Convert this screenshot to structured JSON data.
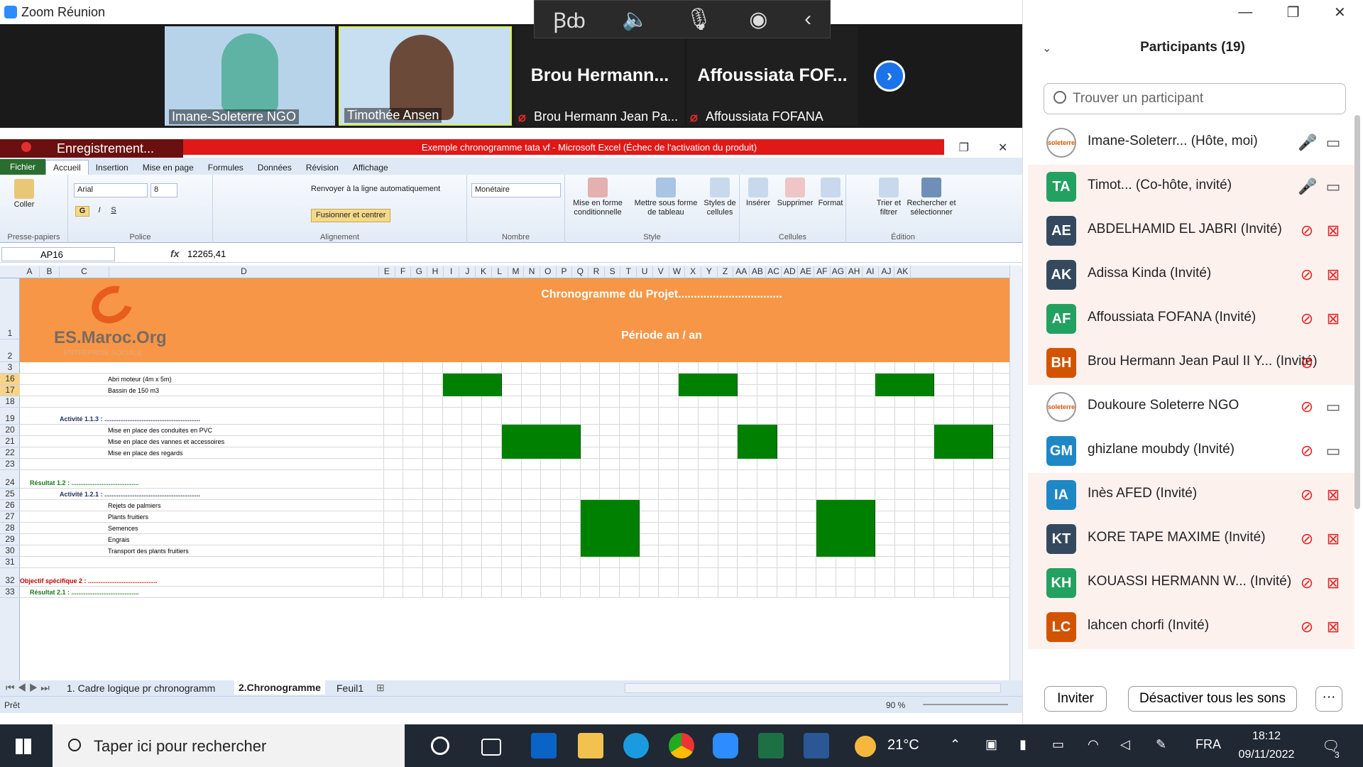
{
  "zoom": {
    "window_title": "Zoom Réunion",
    "floating_bar_icons": [
      "accessibility-icon",
      "speaker-icon",
      "mic-icon",
      "broadcast-icon",
      "back-icon"
    ],
    "videos": [
      {
        "name": "Imane-Soleterre NGO"
      },
      {
        "name": "Timothée Ansen"
      }
    ],
    "name_tiles": [
      {
        "big": "Brou Hermann...",
        "small": "Brou Hermann Jean Pa..."
      },
      {
        "big": "Affoussiata FOF...",
        "small": "Affoussiata FOFANA"
      }
    ],
    "recording": "Enregistrement..."
  },
  "excel": {
    "title": "Exemple chronogramme tata vf - Microsoft Excel (Échec de l'activation du produit)",
    "tabs": [
      "Fichier",
      "Accueil",
      "Insertion",
      "Mise en page",
      "Formules",
      "Données",
      "Révision",
      "Affichage"
    ],
    "ribbon": {
      "coller": "Coller",
      "presse_papiers": "Presse-papiers",
      "font_name": "Arial",
      "font_size": "8",
      "police": "Police",
      "wrap": "Renvoyer à la ligne automatiquement",
      "merge": "Fusionner et centrer",
      "alignement": "Alignement",
      "number_format": "Monétaire",
      "nombre": "Nombre",
      "cond_format": "Mise en forme conditionnelle",
      "table_format": "Mettre sous forme de tableau",
      "cell_styles": "Styles de cellules",
      "style": "Style",
      "inserer": "Insérer",
      "supprimer": "Supprimer",
      "format": "Format",
      "cellules": "Cellules",
      "trier": "Trier et filtrer",
      "rechercher": "Rechercher et sélectionner",
      "edition": "Édition"
    },
    "name_box": "AP16",
    "formula_value": "12265,41",
    "columns": [
      "A",
      "B",
      "C",
      "D",
      "E",
      "F",
      "G",
      "H",
      "I",
      "J",
      "K",
      "L",
      "M",
      "N",
      "O",
      "P",
      "Q",
      "R",
      "S",
      "T",
      "U",
      "V",
      "W",
      "X",
      "Y",
      "Z",
      "AA",
      "AB",
      "AC",
      "AD",
      "AE",
      "AF",
      "AG",
      "AH",
      "AI",
      "AJ",
      "AK"
    ],
    "header_title": "Chronogramme du Projet.................................",
    "header_period": "Période an / an",
    "logo_text": "ES.Maroc.Org",
    "logo_sub": "ENTREPRISE SOCIALE",
    "rows": [
      {
        "num": "1",
        "text": ""
      },
      {
        "num": "2",
        "text": ""
      },
      {
        "num": "3",
        "text": ""
      },
      {
        "num": "16",
        "text": "Abri moteur (4m x 5m)"
      },
      {
        "num": "17",
        "text": "Bassin de 150 m3"
      },
      {
        "num": "18",
        "text": ""
      },
      {
        "num": "19",
        "text": "Activité 1.1.3 : ......................................................"
      },
      {
        "num": "20",
        "text": "Mise en place des conduites en PVC"
      },
      {
        "num": "21",
        "text": "Mise en place des vannes et accessoires"
      },
      {
        "num": "22",
        "text": "Mise en place des regards"
      },
      {
        "num": "23",
        "text": ""
      },
      {
        "num": "24",
        "text": "Résultat 1.2 : ......................................"
      },
      {
        "num": "25",
        "text": "Activité 1.2.1 : ......................................................"
      },
      {
        "num": "26",
        "text": "Rejets de palmiers"
      },
      {
        "num": "27",
        "text": "Plants fruitiers"
      },
      {
        "num": "28",
        "text": "Semences"
      },
      {
        "num": "29",
        "text": "Engrais"
      },
      {
        "num": "30",
        "text": "Transport des plants fruitiers"
      },
      {
        "num": "31",
        "text": ""
      },
      {
        "num": "32",
        "text": "Objectif spécifique 2 : ......................................."
      },
      {
        "num": "33",
        "text": "Résultat 2.1 : ......................................"
      }
    ],
    "sheet_tabs": [
      "1. Cadre logique pr chronogramm",
      "2.Chronogramme",
      "Feuil1"
    ],
    "status": "Prêt",
    "zoom": "90 %"
  },
  "participants": {
    "title": "Participants (19)",
    "search_placeholder": "Trouver un participant",
    "list": [
      {
        "initials": "",
        "name": "Imane-Soleterr...  (Hôte, moi)",
        "color": "#ffffff",
        "mic": "on",
        "cam": "on",
        "logo": "soleterre"
      },
      {
        "initials": "TA",
        "name": "Timot...  (Co-hôte, invité)",
        "color": "#23a160",
        "mic": "on",
        "cam": "on"
      },
      {
        "initials": "AE",
        "name": "ABDELHAMID EL JABRI (Invité)",
        "color": "#34495e",
        "mic": "off",
        "cam": "off"
      },
      {
        "initials": "AK",
        "name": "Adissa Kinda (Invité)",
        "color": "#34495e",
        "mic": "off",
        "cam": "off"
      },
      {
        "initials": "AF",
        "name": "Affoussiata FOFANA (Invité)",
        "color": "#23a160",
        "mic": "off",
        "cam": "off"
      },
      {
        "initials": "BH",
        "name": "Brou Hermann Jean Paul II Y...  (Invité)",
        "color": "#d35400",
        "mic": "off",
        "cam": ""
      },
      {
        "initials": "",
        "name": "Doukoure Soleterre NGO",
        "color": "#ffffff",
        "mic": "off",
        "cam": "on",
        "logo": "soleterre"
      },
      {
        "initials": "GM",
        "name": "ghizlane moubdy (Invité)",
        "color": "#1e88c6",
        "mic": "off",
        "cam": "on"
      },
      {
        "initials": "IA",
        "name": "Inès AFED (Invité)",
        "color": "#1e88c6",
        "mic": "off",
        "cam": "off"
      },
      {
        "initials": "KT",
        "name": "KORE TAPE MAXIME (Invité)",
        "color": "#34495e",
        "mic": "off",
        "cam": "off"
      },
      {
        "initials": "KH",
        "name": "KOUASSI HERMANN W...  (Invité)",
        "color": "#23a160",
        "mic": "off",
        "cam": "off"
      },
      {
        "initials": "LC",
        "name": "lahcen chorfi (Invité)",
        "color": "#d35400",
        "mic": "off",
        "cam": "off"
      }
    ],
    "invite": "Inviter",
    "mute_all": "Désactiver tous les sons",
    "more": "···"
  },
  "taskbar": {
    "search": "Taper ici pour rechercher",
    "weather": "21°C",
    "lang": "FRA",
    "time": "18:12",
    "date": "09/11/2022",
    "notif": "3"
  }
}
